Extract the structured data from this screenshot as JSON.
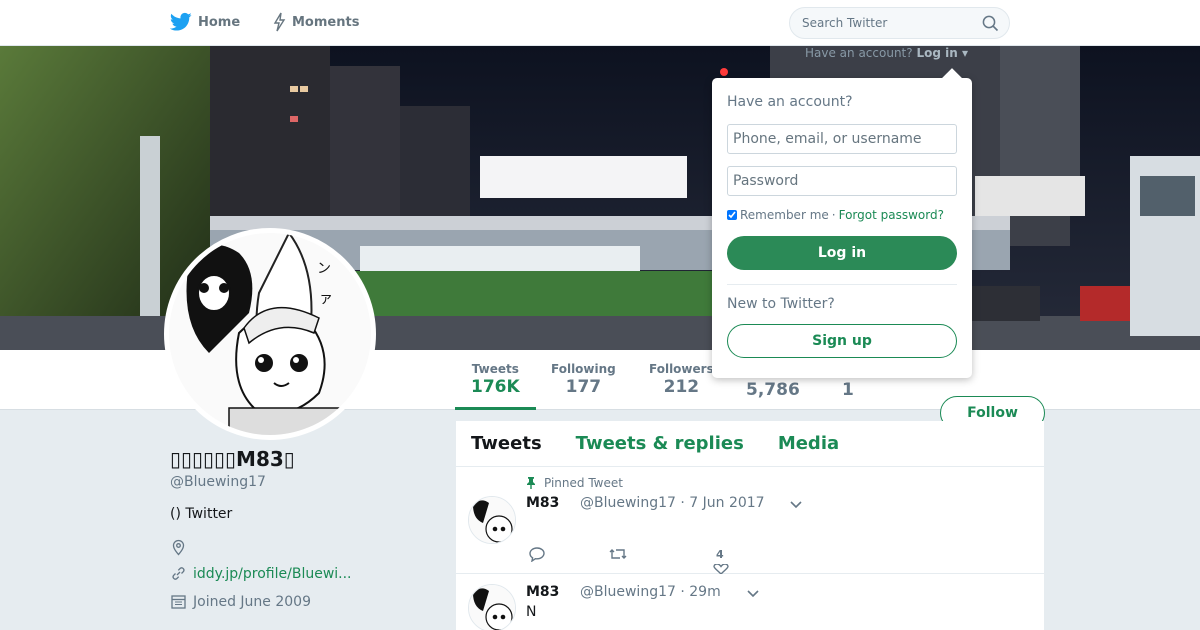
{
  "nav": {
    "home_label": "Home",
    "moments_label": "Moments",
    "search_placeholder": "Search Twitter"
  },
  "account_hint": {
    "text": "Have an account?",
    "login_label": "Log in"
  },
  "login_dropdown": {
    "title": "Have an account?",
    "username_placeholder": "Phone, email, or username",
    "password_placeholder": "Password",
    "remember_label": "Remember me",
    "separator": " · ",
    "forgot_label": "Forgot password?",
    "login_button": "Log in",
    "new_label": "New to Twitter?",
    "signup_button": "Sign up"
  },
  "stats": [
    {
      "label": "Tweets",
      "value": "176K"
    },
    {
      "label": "Following",
      "value": "177"
    },
    {
      "label": "Followers",
      "value": "212"
    },
    {
      "label": "",
      "value": "5,786"
    },
    {
      "label": "",
      "value": "1"
    }
  ],
  "follow_button": "Follow",
  "profile": {
    "name": "▯▯▯▯▯▯M83▯",
    "handle": "@Bluewing17",
    "bio": "() Twitter",
    "location": "",
    "url": "iddy.jp/profile/Bluewi...",
    "joined": "Joined June 2009"
  },
  "tabs": [
    "Tweets",
    "Tweets & replies",
    "Media"
  ],
  "tweets": [
    {
      "pinned_label": "Pinned Tweet",
      "name": "M83",
      "handle": "@Bluewing17",
      "time": "· 7 Jun 2017",
      "text": "",
      "like_count": "4"
    },
    {
      "name": "M83",
      "handle": "@Bluewing17",
      "time": "· 29m",
      "text": "N"
    }
  ],
  "colors": {
    "accent": "#1b8a55",
    "twitter_blue": "#1da1f2"
  }
}
